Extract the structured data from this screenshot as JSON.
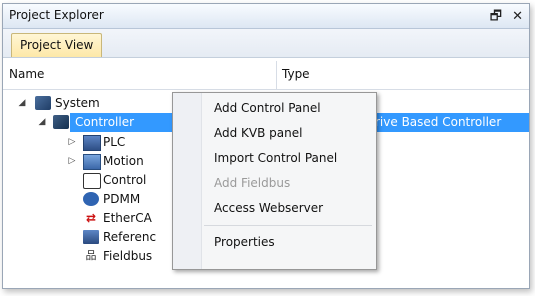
{
  "window": {
    "title": "Project Explorer",
    "controls": {
      "restore": "🗗",
      "close": "✕"
    }
  },
  "tabs": [
    {
      "label": "Project View"
    }
  ],
  "columns": {
    "name": "Name",
    "type": "Type"
  },
  "tree": {
    "root": {
      "label": "System",
      "expander": "◢"
    },
    "controller": {
      "label": "Controller",
      "expander": "◢",
      "type": "rive Based Controller"
    },
    "children": [
      {
        "label": "PLC",
        "expander": "▷"
      },
      {
        "label": "Motion",
        "expander": "▷"
      },
      {
        "label": "Control"
      },
      {
        "label": "PDMM"
      },
      {
        "label": "EtherCA"
      },
      {
        "label": "Referenc"
      },
      {
        "label": "Fieldbus"
      }
    ]
  },
  "context_menu": {
    "items": [
      {
        "label": "Add Control Panel",
        "enabled": true
      },
      {
        "label": "Add KVB panel",
        "enabled": true
      },
      {
        "label": "Import Control Panel",
        "enabled": true
      },
      {
        "label": "Add Fieldbus",
        "enabled": false
      },
      {
        "label": "Access Webserver",
        "enabled": true
      },
      {
        "label": "Properties",
        "enabled": true
      }
    ]
  },
  "colors": {
    "selection": "#3399ff",
    "tab_active": "#fde8a8",
    "disabled_text": "#9a9a9a"
  }
}
